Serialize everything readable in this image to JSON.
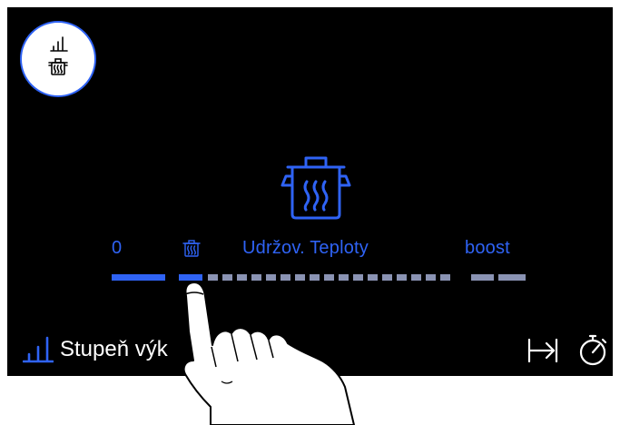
{
  "program": {
    "mode_icon": "power-bars-over-pot-icon",
    "main_icon": "steaming-pot-icon"
  },
  "scale": {
    "label_zero": "0",
    "label_keep_warm": "Udržov. Teploty",
    "label_boost": "boost",
    "keep_warm_icon": "small-pot-icon",
    "active_level": "keep warm",
    "segments_total": 16
  },
  "bottom_bar": {
    "power_label": "Stupeň výk",
    "power_icon": "power-level-bars-icon",
    "expand_icon": "chevron-up-icon",
    "jump_icon": "arrow-to-bar-icon",
    "timer_icon": "stopwatch-icon"
  },
  "colors": {
    "accent": "#2f63f5",
    "inactive_segment": "#8a93b3",
    "background": "#000000",
    "text": "#ffffff"
  }
}
